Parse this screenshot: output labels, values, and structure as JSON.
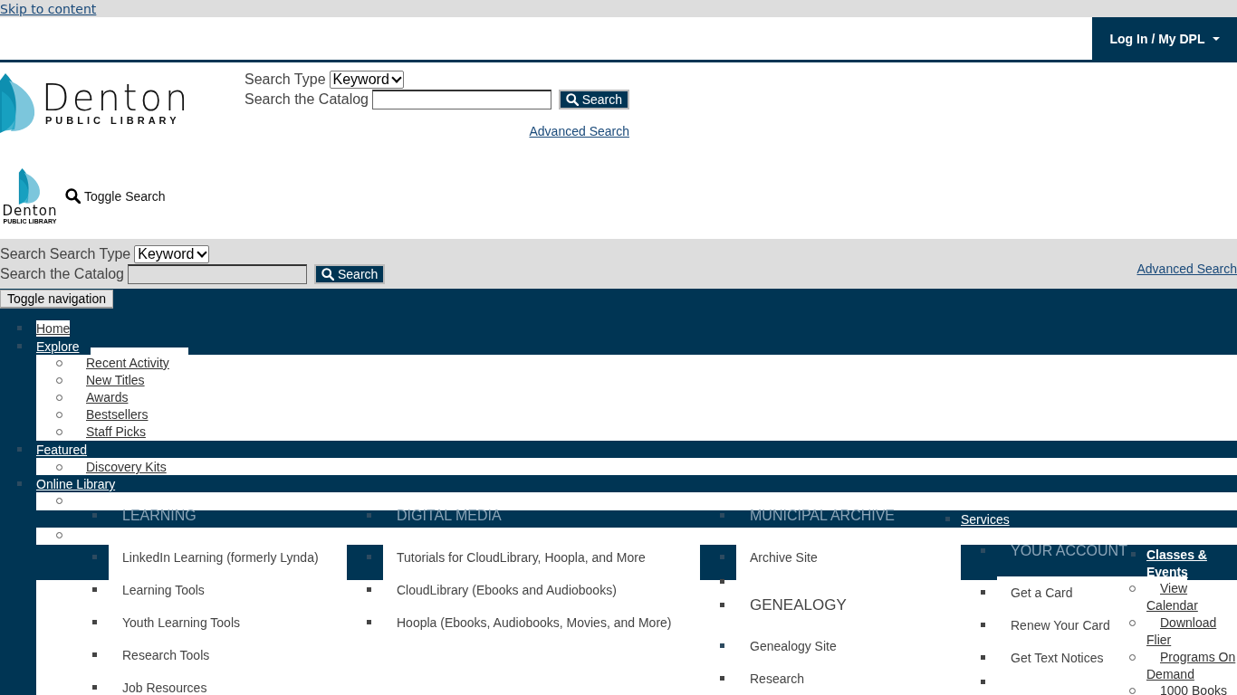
{
  "skip_link": "Skip to content",
  "account_button": {
    "label": "Log In / My DPL"
  },
  "logo": {
    "name": "Denton",
    "tagline": "PUBLIC LIBRARY"
  },
  "search": {
    "type_label": "Search Type",
    "type_value": "Keyword",
    "catalog_label": "Search the Catalog",
    "button": "Search",
    "advanced": "Advanced Search"
  },
  "mobile_header": {
    "logo": {
      "name": "Denton",
      "tagline": "PUBLIC LIBRARY"
    },
    "toggle_search": "Toggle Search"
  },
  "search_bar": {
    "prefix": "Search",
    "type_label": "Search Type",
    "type_value": "Keyword",
    "catalog_label": "Search the Catalog",
    "button": "Search",
    "advanced": "Advanced Search"
  },
  "toggle_navigation": "Toggle navigation",
  "menu": [
    {
      "label": "Home",
      "selected": true
    },
    {
      "label": "Explore",
      "selected": false,
      "children": [
        "Recent Activity",
        "New Titles",
        "Awards",
        "Bestsellers",
        "Staff Picks"
      ]
    },
    {
      "label": "Featured",
      "selected": false,
      "children": [
        "Discovery Kits"
      ]
    },
    {
      "label": "Online Library",
      "selected": false
    }
  ],
  "online_library": [
    {
      "heading": "LEARNING",
      "items": [
        "LinkedIn Learning (formerly Lynda)",
        "Learning Tools",
        "Youth Learning Tools",
        "Research Tools",
        "Job Resources"
      ]
    },
    {
      "heading": "DIGITAL MEDIA",
      "items": [
        "Tutorials for CloudLibrary, Hoopla, and More",
        "CloudLibrary (Ebooks and Audiobooks)",
        "Hoopla (Ebooks, Audiobooks, Movies, and More)"
      ]
    },
    {
      "heading": "MUNICIPAL ARCHIVE",
      "items": [
        "Archive Site"
      ]
    },
    {
      "heading": "GENEALOGY",
      "items": [
        "Genealogy Site",
        "Research"
      ]
    }
  ],
  "services": {
    "label": "Services",
    "heading": "YOUR ACCOUNT",
    "items": [
      "Get a Card",
      "Renew Your Card",
      "Get Text Notices"
    ]
  },
  "classes": {
    "label": "Classes & Events",
    "items": [
      "View Calendar",
      "Download Flier",
      "Programs On Demand",
      "1000 Books"
    ]
  }
}
